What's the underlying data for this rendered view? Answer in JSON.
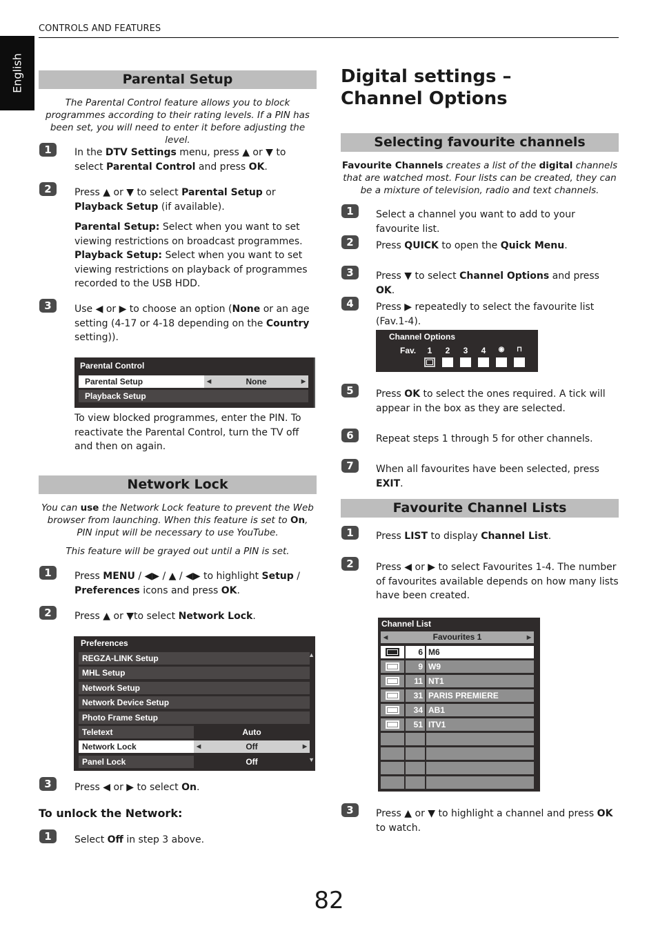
{
  "header": {
    "section": "CONTROLS AND FEATURES",
    "language_tab": "English"
  },
  "page_number": "82",
  "parental_setup": {
    "heading": "Parental Setup",
    "intro": "The Parental Control feature allows you to block programmes according to their rating levels. If a PIN has been set, you will need to enter it before adjusting the level.",
    "steps": [
      {
        "num": "1",
        "html": "In the <b>DTV Settings</b> menu, press ▲ or ▼ to select <b>Parental Control</b> and press <b>OK</b>."
      },
      {
        "num": "2",
        "html": "Press ▲ or ▼ to select <b>Parental Setup</b> or <b>Playback Setup</b> (if available)."
      },
      {
        "num": "3",
        "html": "Use ◀ or ▶ to choose an option (<b>None</b> or an age setting (4-17 or 4-18 depending on the <b>Country</b> setting))."
      }
    ],
    "details_html": "<b>Parental Setup:</b> Select when you want to set viewing restrictions on broadcast programmes.<br><b>Playback Setup:</b> Select when you want to set viewing restrictions on playback of programmes recorded to the USB HDD.",
    "menu": {
      "title": "Parental Control",
      "rows": [
        {
          "label": "Parental Setup",
          "value": "None",
          "selected": true
        },
        {
          "label": "Playback Setup",
          "value": "",
          "selected": false
        }
      ]
    },
    "after_text": "To view blocked programmes, enter the PIN. To reactivate the Parental Control, turn the TV off and then on again."
  },
  "network_lock": {
    "heading": "Network Lock",
    "intro_html": "You can <b>use</b> the Network Lock feature to prevent the Web browser from launching. When this feature is set to <b>On</b>, PIN input will be necessary to use YouTube.",
    "note": "This feature will be grayed out until a PIN is set.",
    "steps": [
      {
        "num": "1",
        "html": "Press <b>MENU</b> / ◀▶ / ▲ / ◀▶ to highlight <b>Setup</b> / <b>Preferences</b> icons and press <b>OK</b>."
      },
      {
        "num": "2",
        "html": "Press ▲ or ▼to select <b>Network Lock</b>."
      },
      {
        "num": "3",
        "html": "Press ◀ or ▶ to select <b>On</b>."
      }
    ],
    "menu": {
      "title": "Preferences",
      "rows": [
        {
          "label": "REGZA-LINK Setup",
          "value": null,
          "selected": false
        },
        {
          "label": "MHL Setup",
          "value": null,
          "selected": false
        },
        {
          "label": "Network Setup",
          "value": null,
          "selected": false
        },
        {
          "label": "Network Device Setup",
          "value": null,
          "selected": false
        },
        {
          "label": "Photo Frame Setup",
          "value": null,
          "selected": false
        },
        {
          "label": "Teletext",
          "value": "Auto",
          "selected": false
        },
        {
          "label": "Network Lock",
          "value": "Off",
          "selected": true
        },
        {
          "label": "Panel Lock",
          "value": "Off",
          "selected": false
        }
      ]
    },
    "unlock_heading": "To unlock the Network:",
    "unlock_steps": [
      {
        "num": "1",
        "html": "Select <b>Off</b> in step 3 above."
      }
    ]
  },
  "digital_settings": {
    "title": "Digital settings – Channel Options",
    "selecting": {
      "heading": "Selecting favourite channels",
      "intro_html": "<b>Favourite Channels</b> creates a list of the <b>digital</b> channels that are watched most. Four lists can be created, they can be a mixture of television, radio and text channels.",
      "steps": [
        {
          "num": "1",
          "html": "Select a channel you want to add to your favourite list."
        },
        {
          "num": "2",
          "html": "Press <b>QUICK</b> to open the <b>Quick Menu</b>."
        },
        {
          "num": "3",
          "html": "Press ▼ to select <b>Channel Options</b> and press <b>OK</b>."
        },
        {
          "num": "4",
          "html": "Press ▶ repeatedly to select the favourite list (Fav.1-4)."
        },
        {
          "num": "5",
          "html": "Press <b>OK</b> to select the ones required. A tick will appear in the box as they are selected."
        },
        {
          "num": "6",
          "html": "Repeat steps 1 through 5 for other channels."
        },
        {
          "num": "7",
          "html": "When all favourites have been selected, press <b>EXIT</b>."
        }
      ],
      "menu": {
        "title": "Channel Options",
        "fav_label": "Fav.",
        "columns": [
          {
            "label": "1",
            "icon": null,
            "focused": true
          },
          {
            "label": "2",
            "icon": null,
            "focused": false
          },
          {
            "label": "3",
            "icon": null,
            "focused": false
          },
          {
            "label": "4",
            "icon": null,
            "focused": false
          },
          {
            "label": "",
            "icon": "skip-icon",
            "focused": false
          },
          {
            "label": "",
            "icon": "lock-icon",
            "focused": false
          }
        ]
      }
    },
    "fav_lists": {
      "heading": "Favourite Channel Lists",
      "steps": [
        {
          "num": "1",
          "html": "Press <b>LIST</b> to display <b>Channel List</b>."
        },
        {
          "num": "2",
          "html": "Press ◀ or ▶ to select Favourites 1-4. The number of favourites available depends on how many lists have been created."
        },
        {
          "num": "3",
          "html": "Press ▲ or ▼ to highlight a channel and press <b>OK</b> to watch."
        }
      ],
      "menu": {
        "title": "Channel List",
        "tab": "Favourites 1",
        "rows": [
          {
            "num": "6",
            "name": "M6",
            "selected": true
          },
          {
            "num": "9",
            "name": "W9",
            "selected": false
          },
          {
            "num": "11",
            "name": "NT1",
            "selected": false
          },
          {
            "num": "31",
            "name": "PARIS PREMIERE",
            "selected": false
          },
          {
            "num": "34",
            "name": "AB1",
            "selected": false
          },
          {
            "num": "51",
            "name": "ITV1",
            "selected": false
          },
          {
            "num": "",
            "name": "",
            "selected": false
          },
          {
            "num": "",
            "name": "",
            "selected": false
          },
          {
            "num": "",
            "name": "",
            "selected": false
          },
          {
            "num": "",
            "name": "",
            "selected": false
          }
        ]
      }
    }
  }
}
